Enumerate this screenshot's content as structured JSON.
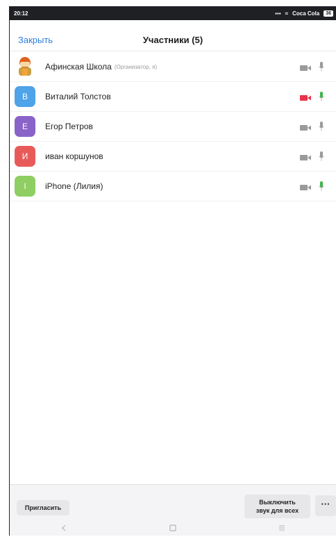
{
  "status_bar": {
    "time": "20:12",
    "carrier": "Coca Cola",
    "battery": "36"
  },
  "header": {
    "close_label": "Закрыть",
    "title": "Участники (5)"
  },
  "participants": [
    {
      "name": "Афинская Школа",
      "role": "(Организатор, я)",
      "avatar_letter": "",
      "avatar_color": "#f2a33a",
      "video_on": false,
      "mic_active": false
    },
    {
      "name": "Виталий Толстов",
      "role": "",
      "avatar_letter": "В",
      "avatar_color": "#4fa3e8",
      "video_on": true,
      "mic_active": true
    },
    {
      "name": "Егор Петров",
      "role": "",
      "avatar_letter": "Е",
      "avatar_color": "#8a63c9",
      "video_on": false,
      "mic_active": false
    },
    {
      "name": "иван коршунов",
      "role": "",
      "avatar_letter": "И",
      "avatar_color": "#e85a5a",
      "video_on": false,
      "mic_active": false
    },
    {
      "name": "iPhone (Лилия)",
      "role": "",
      "avatar_letter": "I",
      "avatar_color": "#8fce62",
      "video_on": false,
      "mic_active": true
    }
  ],
  "bottom_bar": {
    "invite_label": "Пригласить",
    "mute_all_line1": "Выключить",
    "mute_all_line2": "звук для всех",
    "more_label": "···"
  },
  "colors": {
    "accent": "#2d7fe0",
    "video_off": "#9a9a9a",
    "video_on": "#e8334a",
    "mic_idle": "#9a9a9a",
    "mic_active": "#3fb54a"
  }
}
